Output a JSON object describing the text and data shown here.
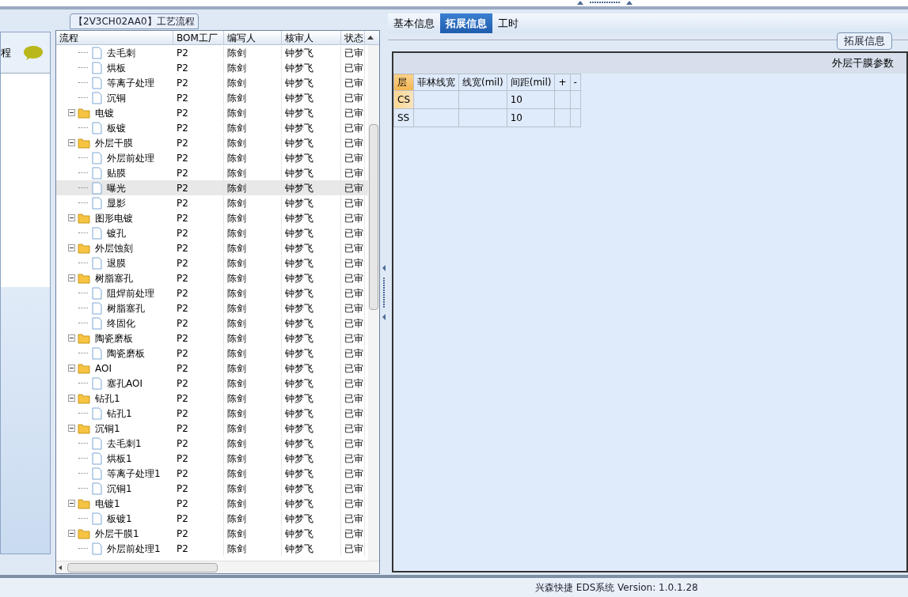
{
  "left_panel": {
    "title": "程"
  },
  "process_panel": {
    "title": "【2V3CH02AA0】工艺流程",
    "columns": [
      "流程",
      "BOM工厂",
      "编写人",
      "核审人",
      "状态"
    ],
    "tree": [
      {
        "children": [
          {
            "label": "去毛刺",
            "bom": "P2",
            "writer": "陈剑",
            "reviewer": "钟梦飞",
            "status": "已审",
            "selected": false
          },
          {
            "label": "烘板",
            "bom": "P2",
            "writer": "陈剑",
            "reviewer": "钟梦飞",
            "status": "已审",
            "selected": false
          },
          {
            "label": "等离子处理",
            "bom": "P2",
            "writer": "陈剑",
            "reviewer": "钟梦飞",
            "status": "已审",
            "selected": false
          },
          {
            "label": "沉铜",
            "bom": "P2",
            "writer": "陈剑",
            "reviewer": "钟梦飞",
            "status": "已审",
            "selected": false
          }
        ]
      },
      {
        "label": "电镀",
        "bom": "P2",
        "writer": "陈剑",
        "reviewer": "钟梦飞",
        "status": "已审",
        "selected": false,
        "expanded": true,
        "children": [
          {
            "label": "板镀",
            "bom": "P2",
            "writer": "陈剑",
            "reviewer": "钟梦飞",
            "status": "已审",
            "selected": false
          }
        ]
      },
      {
        "label": "外层干膜",
        "bom": "P2",
        "writer": "陈剑",
        "reviewer": "钟梦飞",
        "status": "已审",
        "selected": false,
        "expanded": true,
        "children": [
          {
            "label": "外层前处理",
            "bom": "P2",
            "writer": "陈剑",
            "reviewer": "钟梦飞",
            "status": "已审",
            "selected": false
          },
          {
            "label": "贴膜",
            "bom": "P2",
            "writer": "陈剑",
            "reviewer": "钟梦飞",
            "status": "已审",
            "selected": false
          },
          {
            "label": "曝光",
            "bom": "P2",
            "writer": "陈剑",
            "reviewer": "钟梦飞",
            "status": "已审",
            "selected": true
          },
          {
            "label": "显影",
            "bom": "P2",
            "writer": "陈剑",
            "reviewer": "钟梦飞",
            "status": "已审",
            "selected": false
          }
        ]
      },
      {
        "label": "图形电镀",
        "bom": "P2",
        "writer": "陈剑",
        "reviewer": "钟梦飞",
        "status": "已审",
        "selected": false,
        "expanded": true,
        "children": [
          {
            "label": "镀孔",
            "bom": "P2",
            "writer": "陈剑",
            "reviewer": "钟梦飞",
            "status": "已审",
            "selected": false
          }
        ]
      },
      {
        "label": "外层蚀刻",
        "bom": "P2",
        "writer": "陈剑",
        "reviewer": "钟梦飞",
        "status": "已审",
        "selected": false,
        "expanded": true,
        "children": [
          {
            "label": "退膜",
            "bom": "P2",
            "writer": "陈剑",
            "reviewer": "钟梦飞",
            "status": "已审",
            "selected": false
          }
        ]
      },
      {
        "label": "树脂塞孔",
        "bom": "P2",
        "writer": "陈剑",
        "reviewer": "钟梦飞",
        "status": "已审",
        "selected": false,
        "expanded": true,
        "children": [
          {
            "label": "阻焊前处理",
            "bom": "P2",
            "writer": "陈剑",
            "reviewer": "钟梦飞",
            "status": "已审",
            "selected": false
          },
          {
            "label": "树脂塞孔",
            "bom": "P2",
            "writer": "陈剑",
            "reviewer": "钟梦飞",
            "status": "已审",
            "selected": false
          },
          {
            "label": "终固化",
            "bom": "P2",
            "writer": "陈剑",
            "reviewer": "钟梦飞",
            "status": "已审",
            "selected": false
          }
        ]
      },
      {
        "label": "陶瓷磨板",
        "bom": "P2",
        "writer": "陈剑",
        "reviewer": "钟梦飞",
        "status": "已审",
        "selected": false,
        "expanded": true,
        "children": [
          {
            "label": "陶瓷磨板",
            "bom": "P2",
            "writer": "陈剑",
            "reviewer": "钟梦飞",
            "status": "已审",
            "selected": false
          }
        ]
      },
      {
        "label": "AOI",
        "bom": "P2",
        "writer": "陈剑",
        "reviewer": "钟梦飞",
        "status": "已审",
        "selected": false,
        "expanded": true,
        "children": [
          {
            "label": "塞孔AOI",
            "bom": "P2",
            "writer": "陈剑",
            "reviewer": "钟梦飞",
            "status": "已审",
            "selected": false
          }
        ]
      },
      {
        "label": "钻孔1",
        "bom": "P2",
        "writer": "陈剑",
        "reviewer": "钟梦飞",
        "status": "已审",
        "selected": false,
        "expanded": true,
        "children": [
          {
            "label": "钻孔1",
            "bom": "P2",
            "writer": "陈剑",
            "reviewer": "钟梦飞",
            "status": "已审",
            "selected": false
          }
        ]
      },
      {
        "label": "沉铜1",
        "bom": "P2",
        "writer": "陈剑",
        "reviewer": "钟梦飞",
        "status": "已审",
        "selected": false,
        "expanded": true,
        "children": [
          {
            "label": "去毛刺1",
            "bom": "P2",
            "writer": "陈剑",
            "reviewer": "钟梦飞",
            "status": "已审",
            "selected": false
          },
          {
            "label": "烘板1",
            "bom": "P2",
            "writer": "陈剑",
            "reviewer": "钟梦飞",
            "status": "已审",
            "selected": false
          },
          {
            "label": "等离子处理1",
            "bom": "P2",
            "writer": "陈剑",
            "reviewer": "钟梦飞",
            "status": "已审",
            "selected": false
          },
          {
            "label": "沉铜1",
            "bom": "P2",
            "writer": "陈剑",
            "reviewer": "钟梦飞",
            "status": "已审",
            "selected": false
          }
        ]
      },
      {
        "label": "电镀1",
        "bom": "P2",
        "writer": "陈剑",
        "reviewer": "钟梦飞",
        "status": "已审",
        "selected": false,
        "expanded": true,
        "children": [
          {
            "label": "板镀1",
            "bom": "P2",
            "writer": "陈剑",
            "reviewer": "钟梦飞",
            "status": "已审",
            "selected": false
          }
        ]
      },
      {
        "label": "外层干膜1",
        "bom": "P2",
        "writer": "陈剑",
        "reviewer": "钟梦飞",
        "status": "已审",
        "selected": false,
        "expanded": true,
        "children": [
          {
            "label": "外层前处理1",
            "bom": "P2",
            "writer": "陈剑",
            "reviewer": "钟梦飞",
            "status": "已审",
            "selected": false
          }
        ]
      }
    ]
  },
  "tabs": [
    {
      "label": "基本信息",
      "selected": false
    },
    {
      "label": "拓展信息",
      "selected": true
    },
    {
      "label": "工时",
      "selected": false
    }
  ],
  "group_box": {
    "title": "拓展信息"
  },
  "params": {
    "title": "外层干膜参数",
    "columns": [
      "层",
      "菲林线宽",
      "线宽(mil)",
      "间距(mil)",
      "+",
      "-"
    ],
    "rows": [
      {
        "cells": [
          "CS",
          "",
          "",
          "10",
          "",
          ""
        ],
        "selected": true
      },
      {
        "cells": [
          "SS",
          "",
          "",
          "10",
          "",
          ""
        ],
        "selected": false
      }
    ]
  },
  "status_bar": {
    "text": "兴森快捷 EDS系统 Version: 1.0.1.28"
  }
}
